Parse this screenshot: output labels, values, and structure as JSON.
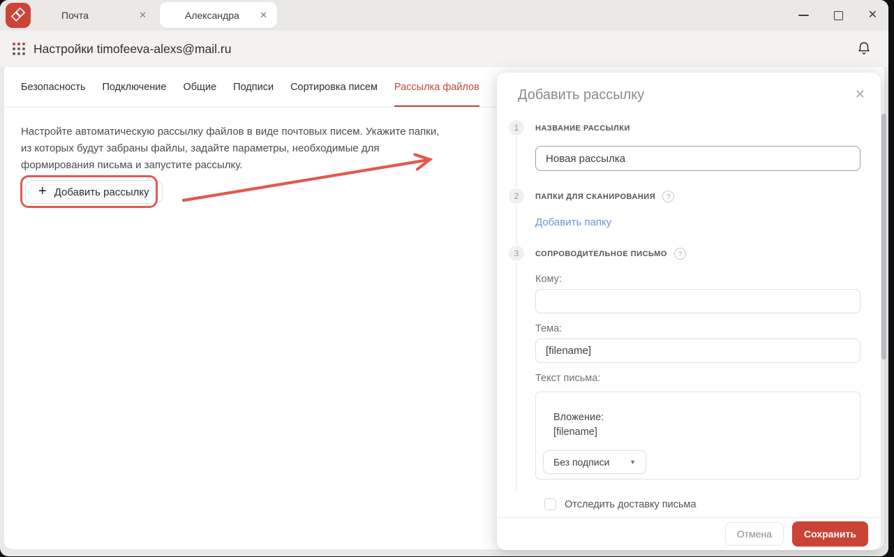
{
  "colors": {
    "accent_red": "#cb4335",
    "annotation_red": "#e05a50",
    "link_blue": "#6b93d6",
    "active_tab_red": "#c5463c",
    "app_icon_red": "#cd4437"
  },
  "icons": {
    "close_glyph": "✕",
    "plus_glyph": "+",
    "help_glyph": "?",
    "caret_down_glyph": "▼"
  },
  "topbar": {
    "tabs": [
      {
        "label": "Почта"
      },
      {
        "label": "Александра"
      }
    ]
  },
  "header": {
    "title": "Настройки timofeeva-alexs@mail.ru"
  },
  "settings_tabs": {
    "items": [
      {
        "label": "Безопасность"
      },
      {
        "label": "Подключение"
      },
      {
        "label": "Общие"
      },
      {
        "label": "Подписи"
      },
      {
        "label": "Сортировка писем"
      },
      {
        "label": "Рассылка файлов"
      }
    ],
    "active_label": "Рассылка файлов"
  },
  "main": {
    "description": "Настройте автоматическую рассылку файлов в виде почтовых писем. Укажите папки, из которых будут забраны файлы, задайте параметры, необходимые для формирования письма и запустите рассылку.",
    "add_button_label": "Добавить рассылку"
  },
  "panel": {
    "title": "Добавить рассылку",
    "steps": [
      {
        "number": "1",
        "label": "НАЗВАНИЕ РАССЫЛКИ"
      },
      {
        "number": "2",
        "label": "ПАПКИ ДЛЯ СКАНИРОВАНИЯ"
      },
      {
        "number": "3",
        "label": "СОПРОВОДИТЕЛЬНОЕ ПИСЬМО"
      }
    ],
    "name_input_value": "Новая рассылка",
    "add_folder_link": "Добавить папку",
    "fields": {
      "to_label": "Кому:",
      "to_value": "",
      "subject_label": "Тема:",
      "subject_value": "[filename]",
      "body_label": "Текст письма:",
      "body_line1": "Вложение:",
      "body_line2": "[filename]",
      "signature_selected": "Без подписи"
    },
    "checkbox_label": "Отследить доставку письма",
    "footer": {
      "cancel_label": "Отмена",
      "save_label": "Сохранить"
    }
  }
}
